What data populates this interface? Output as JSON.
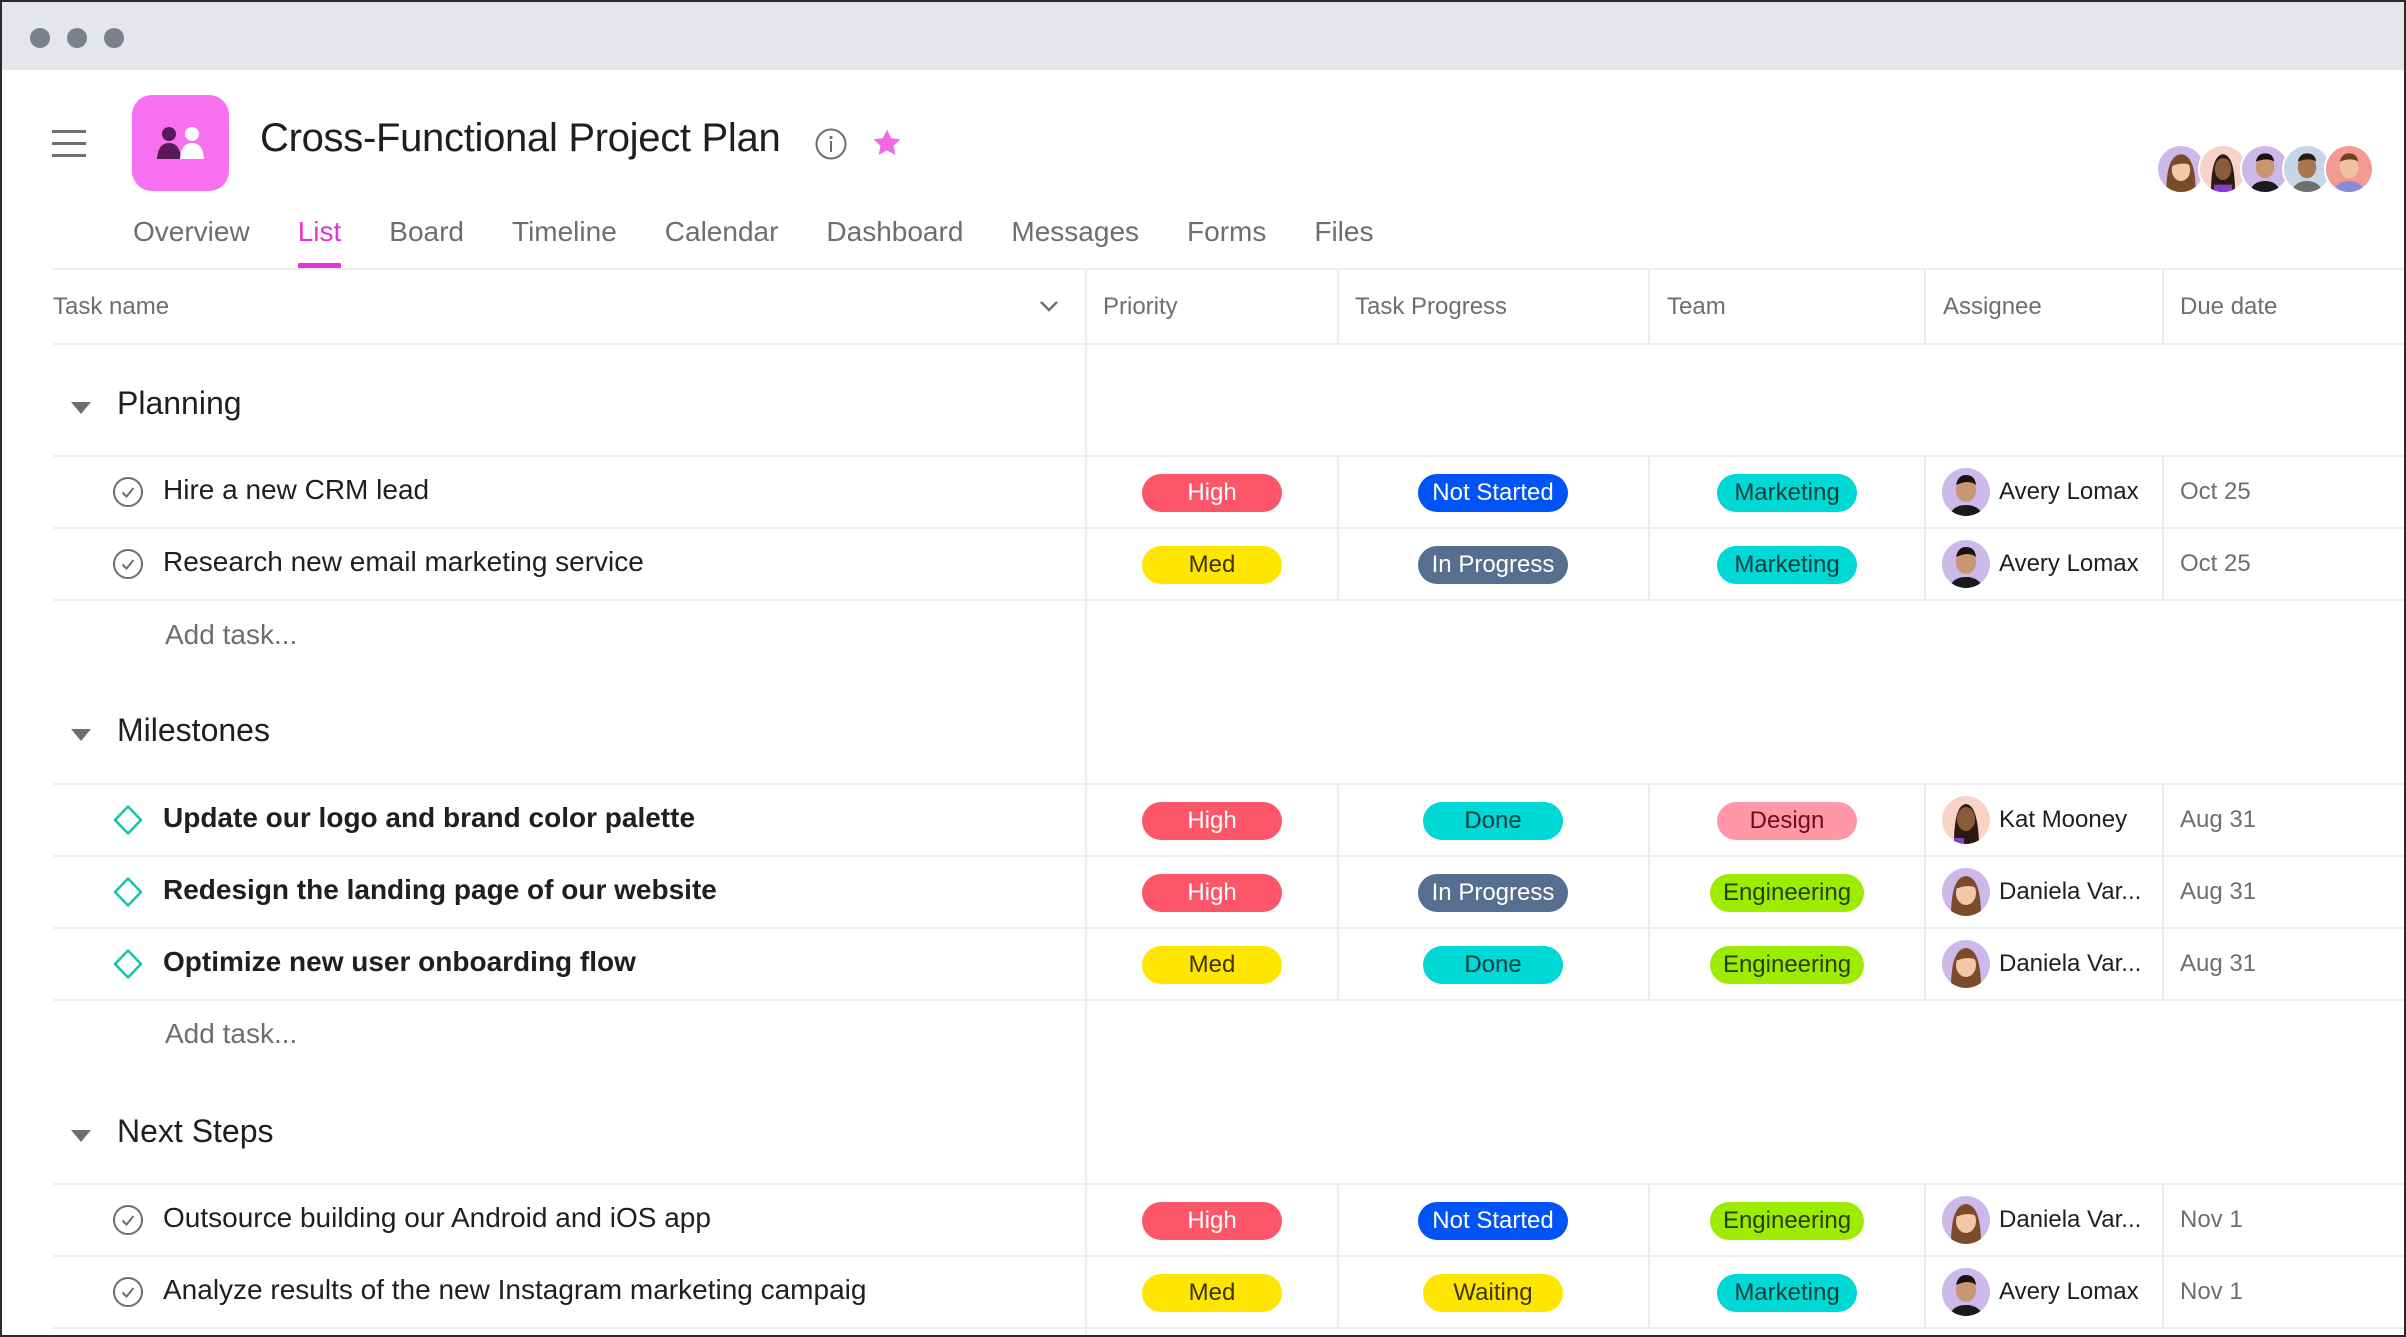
{
  "window": {
    "controls": [
      "close",
      "minimize",
      "maximize"
    ]
  },
  "header": {
    "title": "Cross-Functional Project Plan",
    "app_icon": "people-icon",
    "app_icon_color": "#f770f0",
    "info_icon": "info-icon",
    "star_icon": "star-icon",
    "star_color": "#f06ae6",
    "members_count": 5
  },
  "tabs": [
    {
      "label": "Overview",
      "active": false
    },
    {
      "label": "List",
      "active": true
    },
    {
      "label": "Board",
      "active": false
    },
    {
      "label": "Timeline",
      "active": false
    },
    {
      "label": "Calendar",
      "active": false
    },
    {
      "label": "Dashboard",
      "active": false
    },
    {
      "label": "Messages",
      "active": false
    },
    {
      "label": "Forms",
      "active": false
    },
    {
      "label": "Files",
      "active": false
    }
  ],
  "accent_color": "#e534d3",
  "columns": {
    "task_name": "Task name",
    "priority": "Priority",
    "progress": "Task Progress",
    "team": "Team",
    "assignee": "Assignee",
    "due_date": "Due date"
  },
  "add_task_label": "Add task...",
  "pill_colors": {
    "High": {
      "bg": "#fd5669",
      "fg": "#ffffff"
    },
    "Med": {
      "bg": "#ffe600",
      "fg": "#3d3400"
    },
    "Not Started": {
      "bg": "#0053f7",
      "fg": "#ffffff"
    },
    "In Progress": {
      "bg": "#566f91",
      "fg": "#ffffff"
    },
    "Done": {
      "bg": "#00d8d6",
      "fg": "#06403f"
    },
    "Waiting": {
      "bg": "#ffe600",
      "fg": "#3d3400"
    },
    "Marketing": {
      "bg": "#00d8d6",
      "fg": "#06403f"
    },
    "Design": {
      "bg": "#ff97a7",
      "fg": "#6b0f1c"
    },
    "Engineering": {
      "bg": "#9ceb00",
      "fg": "#264000"
    }
  },
  "sections": [
    {
      "name": "Planning",
      "tasks": [
        {
          "name": "Hire a new CRM lead",
          "type": "task",
          "priority": "High",
          "progress": "Not Started",
          "team": "Marketing",
          "assignee": "Avery Lomax",
          "due": "Oct 25"
        },
        {
          "name": "Research new email marketing service",
          "type": "task",
          "priority": "Med",
          "progress": "In Progress",
          "team": "Marketing",
          "assignee": "Avery Lomax",
          "due": "Oct 25"
        }
      ]
    },
    {
      "name": "Milestones",
      "tasks": [
        {
          "name": "Update our logo and brand color palette",
          "type": "milestone",
          "priority": "High",
          "progress": "Done",
          "team": "Design",
          "assignee": "Kat Mooney",
          "due": "Aug 31"
        },
        {
          "name": "Redesign the landing page of our website",
          "type": "milestone",
          "priority": "High",
          "progress": "In Progress",
          "team": "Engineering",
          "assignee": "Daniela Var...",
          "due": "Aug 31"
        },
        {
          "name": "Optimize new user onboarding flow",
          "type": "milestone",
          "priority": "Med",
          "progress": "Done",
          "team": "Engineering",
          "assignee": "Daniela Var...",
          "due": "Aug 31"
        }
      ]
    },
    {
      "name": "Next Steps",
      "tasks": [
        {
          "name": "Outsource building our Android and iOS app",
          "type": "task",
          "priority": "High",
          "progress": "Not Started",
          "team": "Engineering",
          "assignee": "Daniela Var...",
          "due": "Nov 1"
        },
        {
          "name": "Analyze results of the new Instagram marketing campaig",
          "type": "task",
          "priority": "Med",
          "progress": "Waiting",
          "team": "Marketing",
          "assignee": "Avery Lomax",
          "due": "Nov 1"
        }
      ]
    }
  ]
}
